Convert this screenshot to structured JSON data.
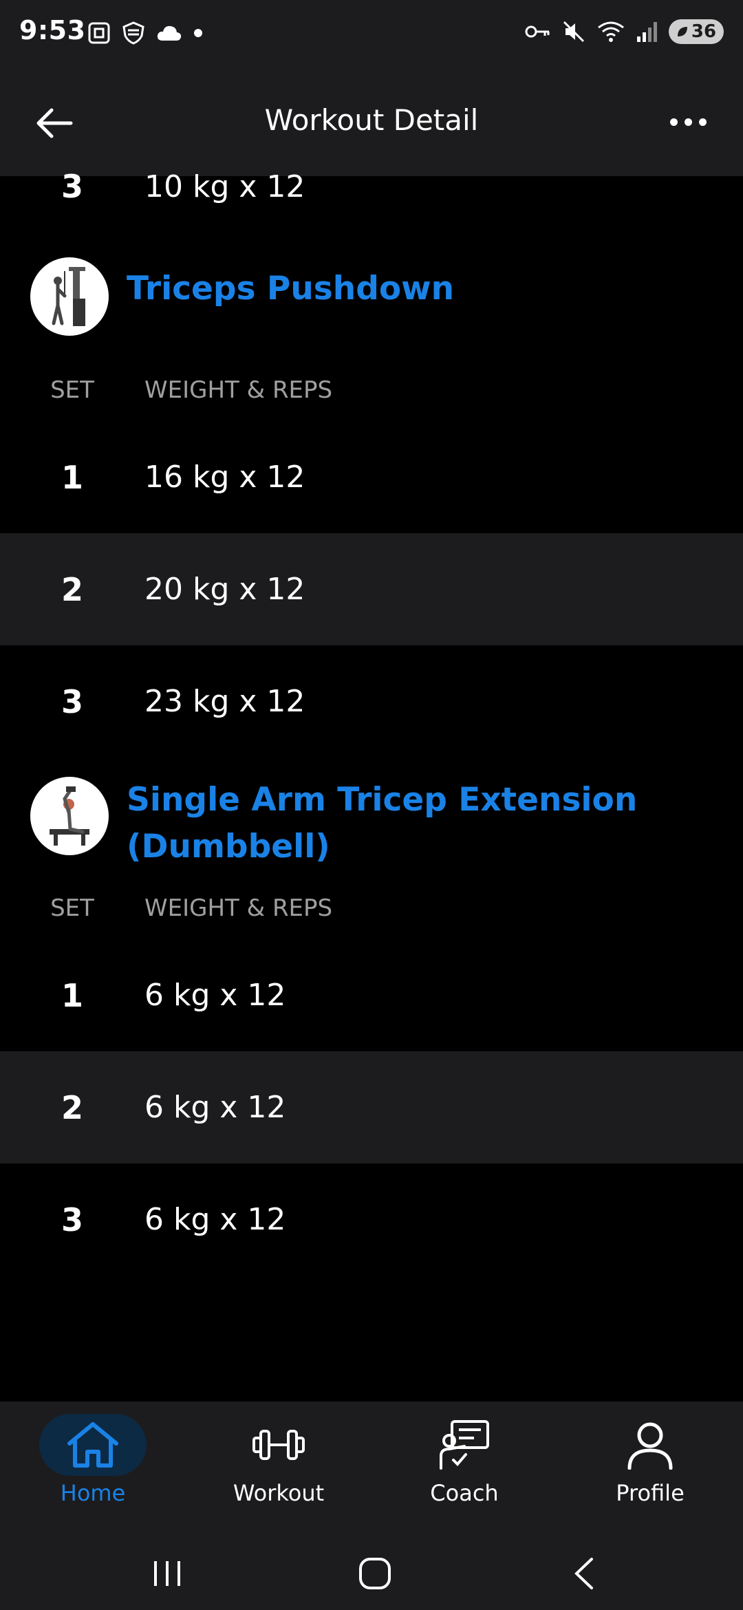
{
  "status": {
    "time": "9:53",
    "battery": "36"
  },
  "header": {
    "title": "Workout Detail"
  },
  "prev_row": {
    "set": "3",
    "value": "10 kg x 12"
  },
  "exercises": [
    {
      "name": "Triceps Pushdown",
      "col_set": "SET",
      "col_weight": "WEIGHT & REPS",
      "sets": [
        {
          "set": "1",
          "value": "16 kg x 12"
        },
        {
          "set": "2",
          "value": "20 kg x 12"
        },
        {
          "set": "3",
          "value": "23 kg x 12"
        }
      ]
    },
    {
      "name_line1": "Single Arm Tricep Extension",
      "name_line2": "(Dumbbell)",
      "col_set": "SET",
      "col_weight": "WEIGHT & REPS",
      "sets": [
        {
          "set": "1",
          "value": "6 kg x 12"
        },
        {
          "set": "2",
          "value": "6 kg x 12"
        },
        {
          "set": "3",
          "value": "6 kg x 12"
        }
      ]
    }
  ],
  "nav": {
    "home": "Home",
    "workout": "Workout",
    "coach": "Coach",
    "profile": "Profile"
  },
  "colors": {
    "accent": "#1a82e6",
    "bar": "#1c1c1e",
    "background": "#000000"
  }
}
